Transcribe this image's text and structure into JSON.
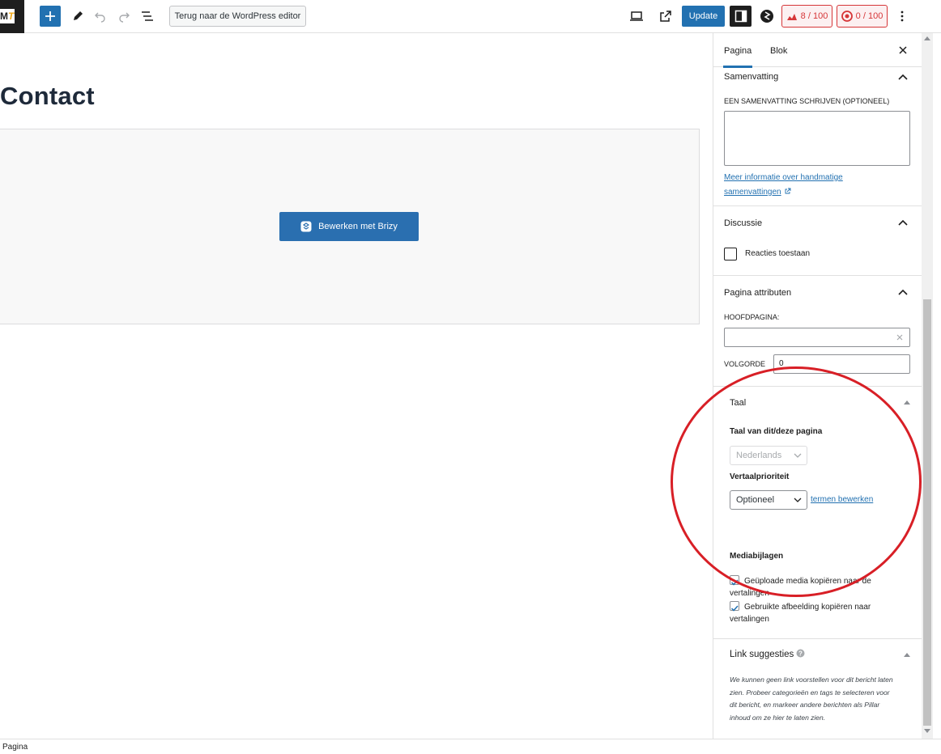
{
  "topbar": {
    "logo_text": "M",
    "logo_accent": "T",
    "back_button": "Terug naar de WordPress editor",
    "update_button": "Update",
    "seo_score": "8 / 100",
    "readability_score": "0 / 100"
  },
  "editor": {
    "page_title": "Contact",
    "brizy_button": "Bewerken met Brizy"
  },
  "footer": {
    "breadcrumb": "Pagina"
  },
  "sidebar": {
    "tabs": [
      "Pagina",
      "Blok"
    ],
    "summary": {
      "heading": "Samenvatting",
      "label": "EEN SAMENVATTING SCHRIJVEN (OPTIONEEL)",
      "link_line1": "Meer informatie over handmatige",
      "link_line2": "samenvattingen"
    },
    "discussion": {
      "heading": "Discussie",
      "allow_comments": "Reacties toestaan"
    },
    "page_attributes": {
      "heading": "Pagina attributen",
      "parent_label": "HOOFDPAGINA:",
      "order_label": "VOLGORDE",
      "order_value": "0"
    },
    "language": {
      "heading": "Taal",
      "lang_label": "Taal van dit/deze pagina",
      "lang_value": "Nederlands",
      "priority_label": "Vertaalprioriteit",
      "priority_value": "Optioneel",
      "edit_terms": "termen bewerken",
      "media_heading": "Mediabijlagen",
      "copy_media_line1": "Geüploade media kopiëren naar de",
      "copy_media_line2": "vertalingen",
      "copy_image_line1": "Gebruikte afbeelding kopiëren naar",
      "copy_image_line2": "vertalingen"
    },
    "link_suggestions": {
      "heading": "Link suggesties",
      "text_line1": "We kunnen geen link voorstellen voor dit bericht laten",
      "text_line2": "zien. Probeer categorieën en tags te selecteren voor",
      "text_line3": "dit bericht, en markeer andere berichten als Pillar",
      "text_line4": "inhoud om ze hier te laten zien."
    }
  },
  "colors": {
    "accent": "#2271b1",
    "annotation": "#d81f26",
    "score_red": "#d63638"
  }
}
